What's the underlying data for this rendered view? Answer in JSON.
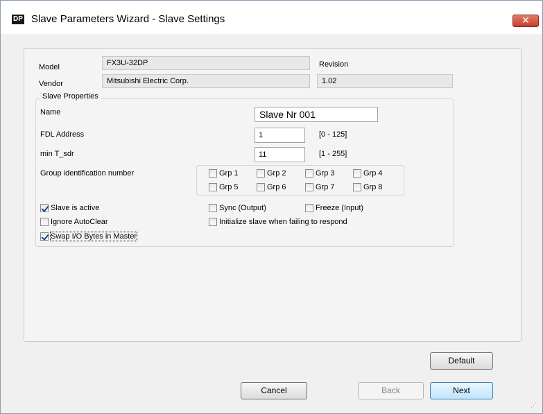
{
  "window": {
    "app_icon": "DP",
    "title": "Slave Parameters Wizard - Slave Settings",
    "close_glyph": "✕"
  },
  "info": {
    "model_label": "Model",
    "model_value": "FX3U-32DP",
    "vendor_label": "Vendor",
    "vendor_value": "Mitsubishi Electric Corp.",
    "revision_label": "Revision",
    "revision_value": "1.02"
  },
  "slave_properties": {
    "legend": "Slave Properties",
    "name_label": "Name",
    "name_value": "Slave Nr 001",
    "fdl_label": "FDL Address",
    "fdl_value": "1",
    "fdl_range": "[0 - 125]",
    "tsdr_label": "min T_sdr",
    "tsdr_value": "11",
    "tsdr_range": "[1 - 255]",
    "group_label": "Group identification number",
    "groups": [
      {
        "label": "Grp 1",
        "checked": false
      },
      {
        "label": "Grp 2",
        "checked": false
      },
      {
        "label": "Grp 3",
        "checked": false
      },
      {
        "label": "Grp 4",
        "checked": false
      },
      {
        "label": "Grp 5",
        "checked": false
      },
      {
        "label": "Grp 6",
        "checked": false
      },
      {
        "label": "Grp 7",
        "checked": false
      },
      {
        "label": "Grp 8",
        "checked": false
      }
    ],
    "options": {
      "slave_active": {
        "label": "Slave is active",
        "checked": true
      },
      "ignore_autoclear": {
        "label": "Ignore AutoClear",
        "checked": false
      },
      "swap_io": {
        "label": "Swap I/O Bytes in Master",
        "checked": true
      },
      "sync_output": {
        "label": "Sync (Output)",
        "checked": false
      },
      "freeze_input": {
        "label": "Freeze (Input)",
        "checked": false
      },
      "init_slave": {
        "label": "Initialize slave when failing to respond",
        "checked": false
      }
    }
  },
  "buttons": {
    "default": "Default",
    "cancel": "Cancel",
    "back": "Back",
    "next": "Next"
  }
}
